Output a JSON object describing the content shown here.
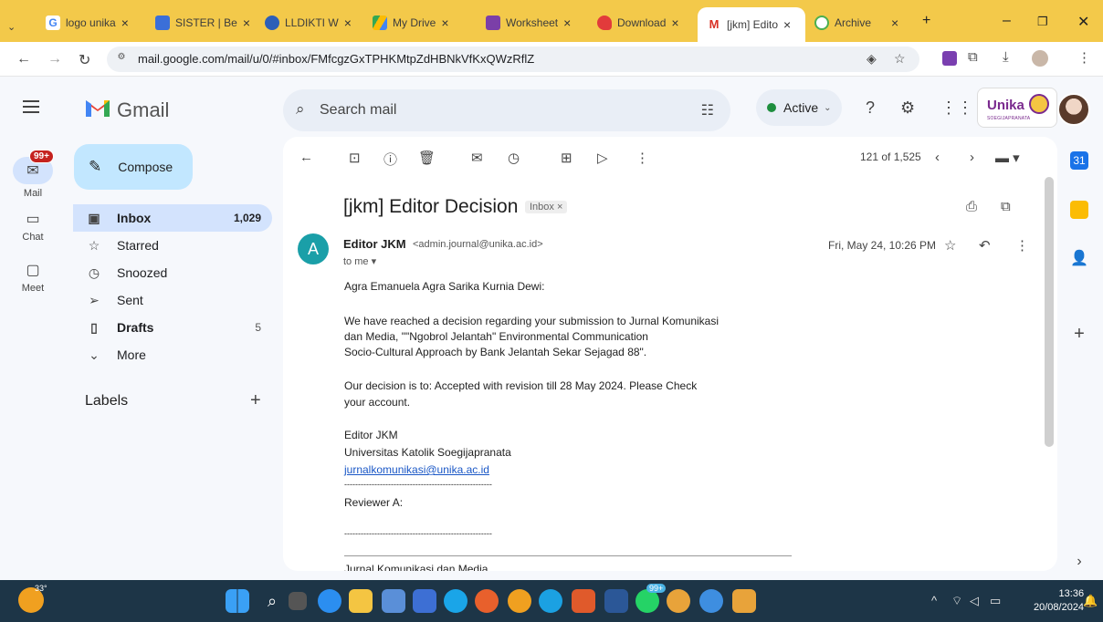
{
  "browser": {
    "tabs": [
      {
        "label": "logo unika",
        "icon": "google-icon"
      },
      {
        "label": "SISTER | Be",
        "icon": "sister-icon"
      },
      {
        "label": "LLDIKTI W",
        "icon": "lldikti-icon"
      },
      {
        "label": "My Drive",
        "icon": "drive-icon"
      },
      {
        "label": "Worksheet",
        "icon": "sheets-icon"
      },
      {
        "label": "Download",
        "icon": "heart-icon"
      },
      {
        "label": "[jkm] Edito",
        "icon": "gmail-icon"
      },
      {
        "label": "Archive",
        "icon": "archive-icon"
      }
    ],
    "url": "mail.google.com/mail/u/0/#inbox/FMfcgzGxTPHKMtpZdHBNkVfKxQWzRflZ"
  },
  "app": {
    "name": "Gmail",
    "search_placeholder": "Search mail",
    "status": "Active"
  },
  "rail": {
    "mail_label": "Mail",
    "mail_badge": "99+",
    "chat_label": "Chat",
    "meet_label": "Meet"
  },
  "nav": {
    "compose": "Compose",
    "items": [
      {
        "label": "Inbox",
        "count": "1,029",
        "icon": "inbox-icon",
        "selected": true
      },
      {
        "label": "Starred",
        "count": "",
        "icon": "star-icon"
      },
      {
        "label": "Snoozed",
        "count": "",
        "icon": "clock-icon"
      },
      {
        "label": "Sent",
        "count": "",
        "icon": "send-icon"
      },
      {
        "label": "Drafts",
        "count": "5",
        "icon": "draft-icon"
      },
      {
        "label": "More",
        "count": "",
        "icon": "chevron-down-icon"
      }
    ],
    "labels_heading": "Labels"
  },
  "message": {
    "pager": "121 of 1,525",
    "subject": "[jkm] Editor Decision",
    "label_chip": "Inbox",
    "sender_initial": "A",
    "sender_name": "Editor JKM",
    "sender_email": "<admin.journal@unika.ac.id>",
    "to": "to me",
    "date": "Fri, May 24, 10:26 PM",
    "body": {
      "greeting": "Agra Emanuela Agra Sarika Kurnia Dewi:",
      "p1_line1": "We have reached a decision regarding your submission to Jurnal Komunikasi",
      "p1_line2": "dan Media, \"\"Ngobrol Jelantah\" Environmental Communication",
      "p1_line3": "Socio-Cultural Approach by Bank Jelantah Sekar Sejagad 88\".",
      "p2_line1": "Our decision is to: Accepted with revision till 28 May 2024. Please Check",
      "p2_line2": "your account.",
      "sig_name": "Editor JKM",
      "sig_org": "Universitas Katolik Soegijapranata",
      "sig_email": "jurnalkomunikasi@unika.ac.id",
      "divider": "------------------------------------------------------",
      "reviewer": "Reviewer A:",
      "divider2": "------------------------------------------------------",
      "footer": "Jurnal Komunikasi dan Media"
    }
  },
  "brand": {
    "unika_name": "Unika",
    "unika_sub": "SOEGIJAPRANATA"
  },
  "taskbar": {
    "temp": "33°",
    "time": "13:36",
    "date": "20/08/2024",
    "badge": "99+"
  },
  "colors": {
    "tabstrip": "#f3c94a",
    "compose": "#c2e7ff",
    "selected_nav": "#d3e3fd",
    "avatar": "#1a9fa8",
    "taskbar": "#1d3547"
  }
}
